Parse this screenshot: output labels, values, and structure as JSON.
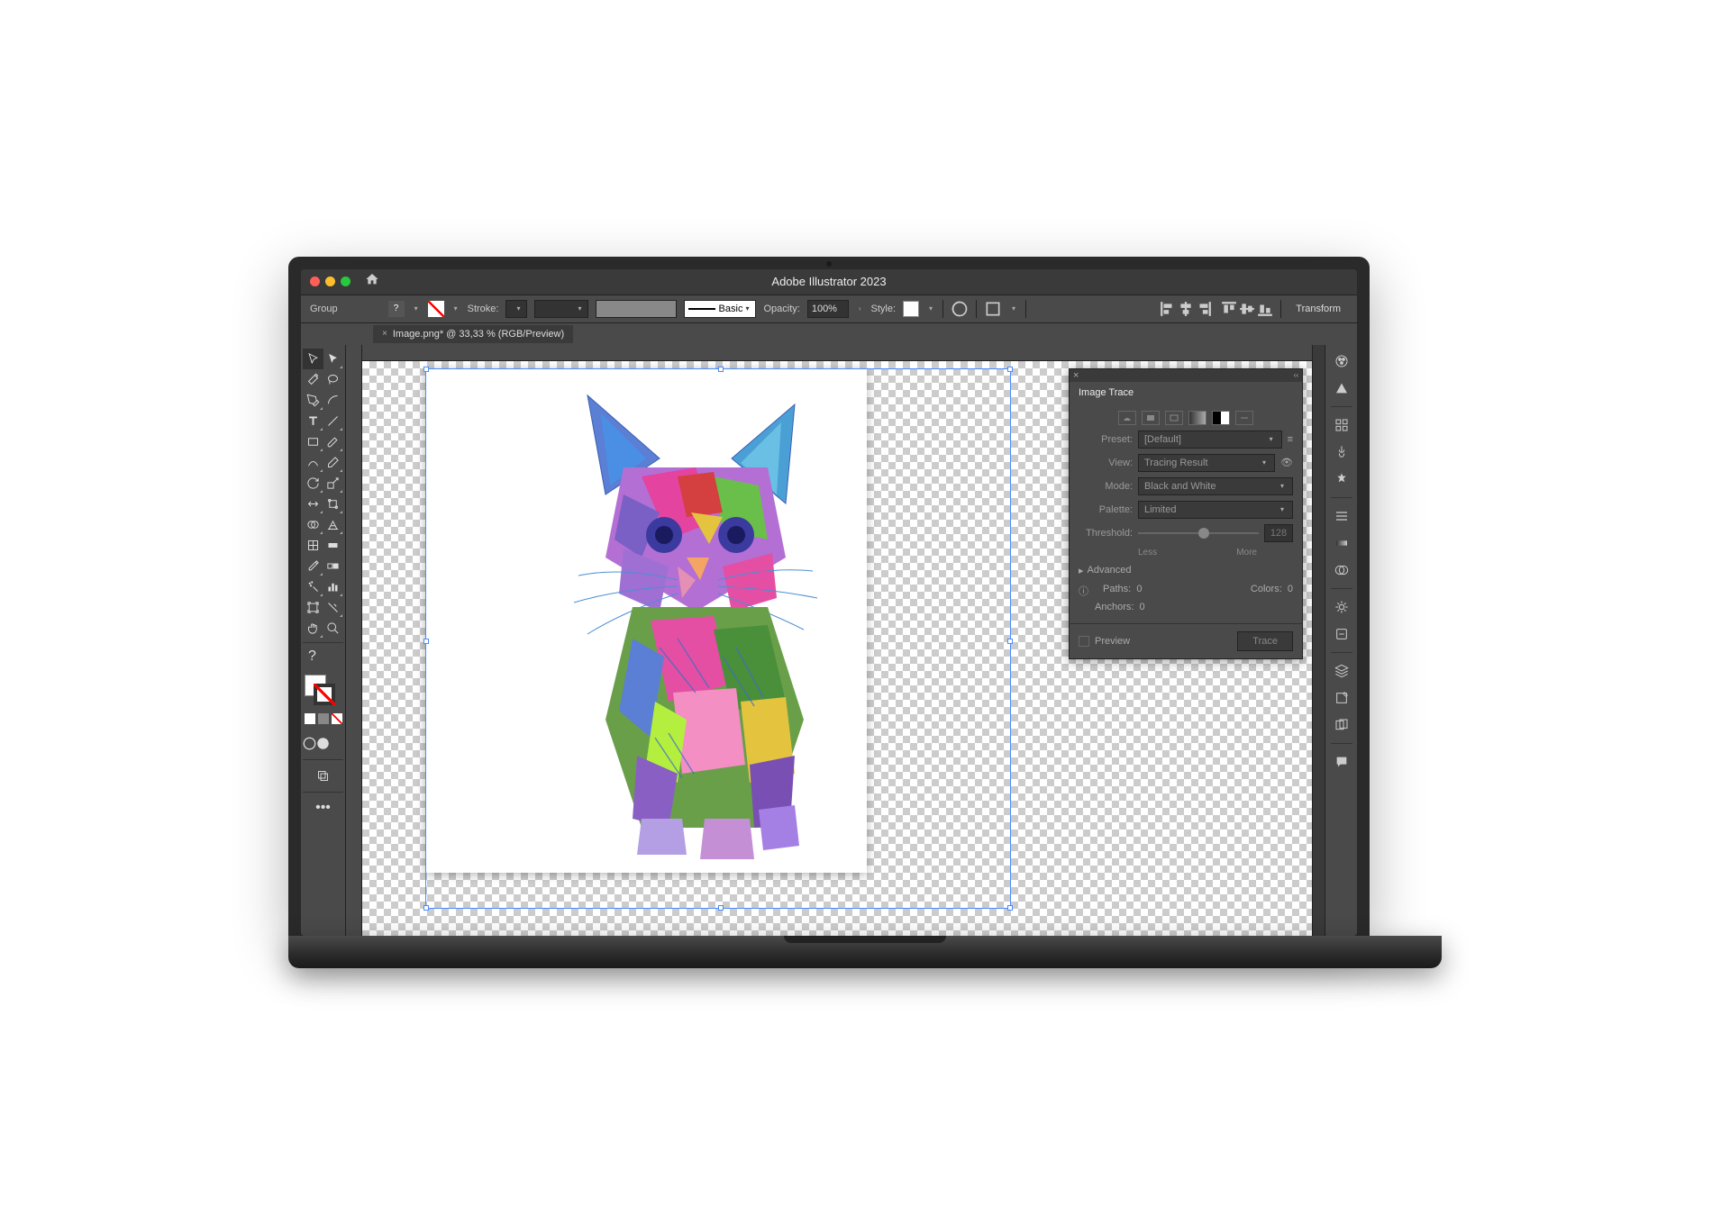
{
  "app": {
    "title": "Adobe Illustrator 2023"
  },
  "options": {
    "group_label": "Group",
    "stroke_label": "Stroke:",
    "brush_label": "Basic",
    "opacity_label": "Opacity:",
    "opacity_value": "100%",
    "style_label": "Style:",
    "transform_label": "Transform"
  },
  "tab": {
    "label": "Image.png* @ 33,33 % (RGB/Preview)"
  },
  "trace": {
    "title": "Image Trace",
    "preset_label": "Preset:",
    "preset_value": "[Default]",
    "view_label": "View:",
    "view_value": "Tracing Result",
    "mode_label": "Mode:",
    "mode_value": "Black and White",
    "palette_label": "Palette:",
    "palette_value": "Limited",
    "threshold_label": "Threshold:",
    "threshold_value": "128",
    "less": "Less",
    "more": "More",
    "advanced": "Advanced",
    "paths_label": "Paths:",
    "paths_value": "0",
    "colors_label": "Colors:",
    "colors_value": "0",
    "anchors_label": "Anchors:",
    "anchors_value": "0",
    "preview": "Preview",
    "trace_btn": "Trace"
  }
}
